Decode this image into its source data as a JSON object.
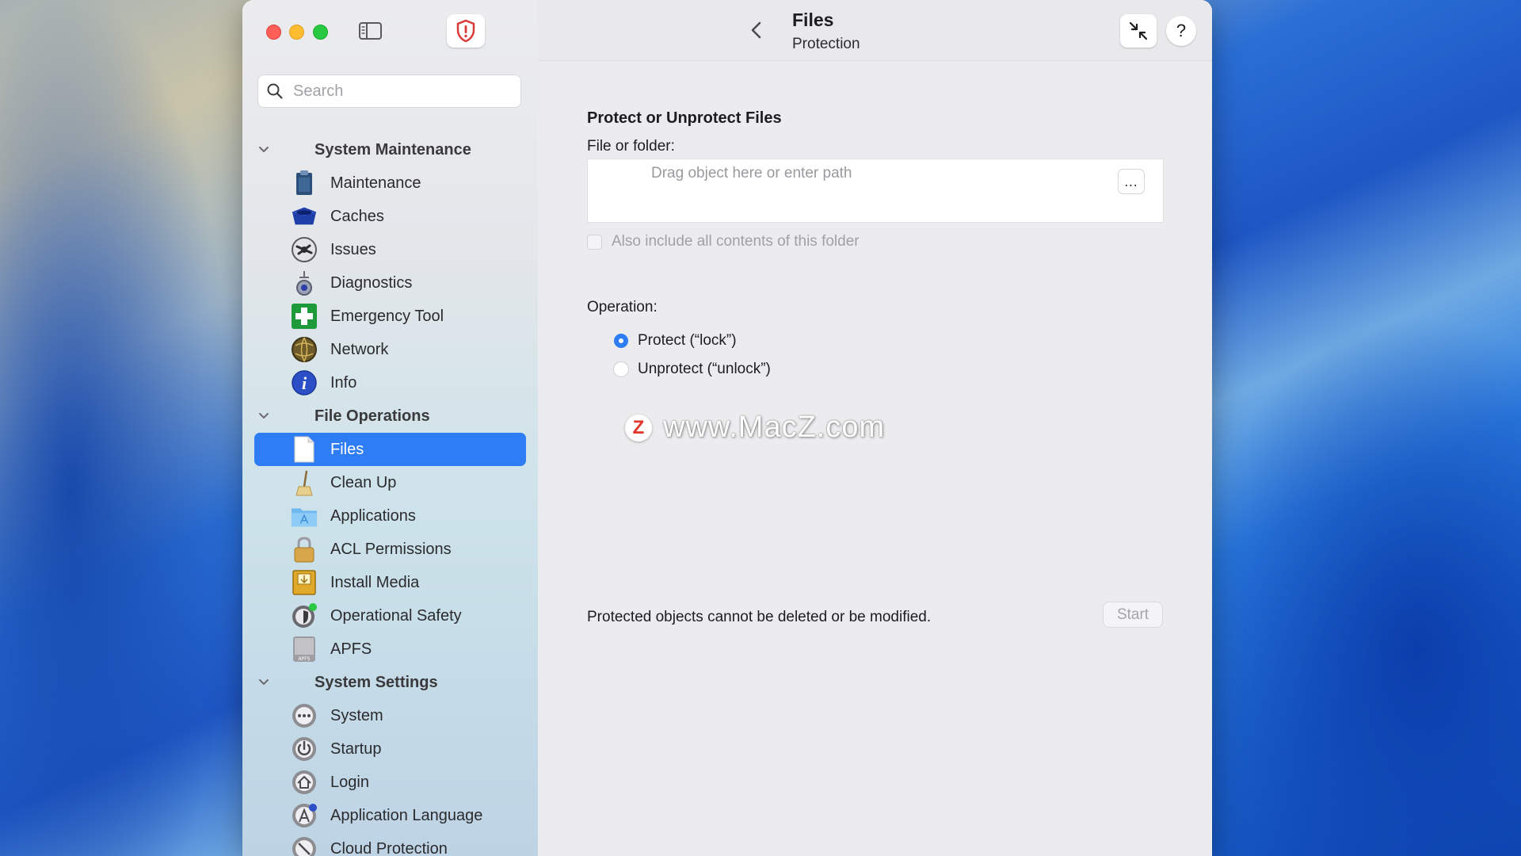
{
  "sidebar": {
    "search_placeholder": "Search",
    "sections": [
      {
        "title": "System Maintenance",
        "items": [
          {
            "label": "Maintenance",
            "icon": "clipboard-icon"
          },
          {
            "label": "Caches",
            "icon": "cache-box-icon"
          },
          {
            "label": "Issues",
            "icon": "issues-icon"
          },
          {
            "label": "Diagnostics",
            "icon": "diagnostics-icon"
          },
          {
            "label": "Emergency Tool",
            "icon": "emergency-cross-icon"
          },
          {
            "label": "Network",
            "icon": "globe-icon"
          },
          {
            "label": "Info",
            "icon": "info-icon"
          }
        ]
      },
      {
        "title": "File Operations",
        "items": [
          {
            "label": "Files",
            "icon": "document-icon",
            "selected": true
          },
          {
            "label": "Clean Up",
            "icon": "broom-icon"
          },
          {
            "label": "Applications",
            "icon": "applications-folder-icon"
          },
          {
            "label": "ACL Permissions",
            "icon": "padlock-icon"
          },
          {
            "label": "Install Media",
            "icon": "install-media-icon"
          },
          {
            "label": "Operational Safety",
            "icon": "safety-shield-icon"
          },
          {
            "label": "APFS",
            "icon": "apfs-disk-icon"
          }
        ]
      },
      {
        "title": "System Settings",
        "items": [
          {
            "label": "System",
            "icon": "system-icon"
          },
          {
            "label": "Startup",
            "icon": "power-icon"
          },
          {
            "label": "Login",
            "icon": "house-icon"
          },
          {
            "label": "Application Language",
            "icon": "language-icon"
          },
          {
            "label": "Cloud Protection",
            "icon": "cloud-protection-icon"
          }
        ]
      }
    ]
  },
  "header": {
    "title": "Files",
    "subtitle": "Protection",
    "help_label": "?"
  },
  "main": {
    "heading": "Protect or Unprotect Files",
    "field_label": "File or folder:",
    "path_placeholder": "Drag object here or enter path",
    "browse_label": "…",
    "include_contents_label": "Also include all contents of this folder",
    "operation_label": "Operation:",
    "options": [
      {
        "label": "Protect (“lock”)",
        "checked": true
      },
      {
        "label": "Unprotect (“unlock”)",
        "checked": false
      }
    ],
    "footer_text": "Protected objects cannot be deleted or be modified.",
    "start_label": "Start"
  },
  "watermark": {
    "logo_letter": "Z",
    "text": "www.MacZ.com"
  },
  "colors": {
    "accent": "#2f7df5",
    "close": "#ff5f57",
    "minimize": "#febc2e",
    "zoom": "#28c840"
  }
}
